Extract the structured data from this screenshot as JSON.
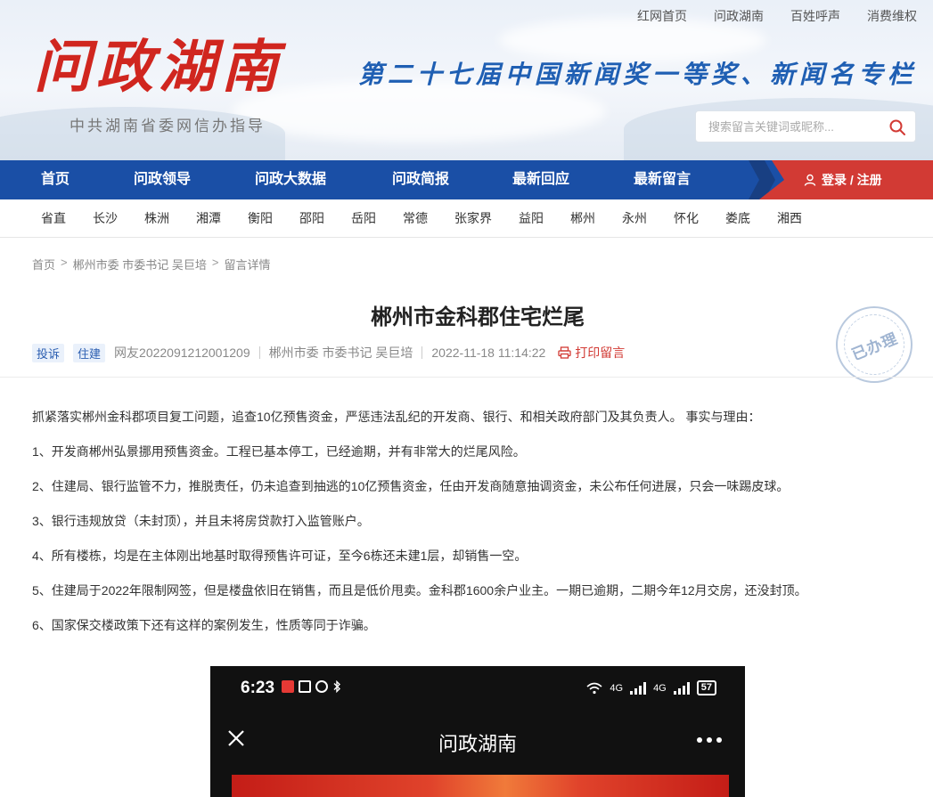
{
  "top_links": [
    "红网首页",
    "问政湖南",
    "百姓呼声",
    "消费维权"
  ],
  "logo": {
    "text": "问政湖南",
    "subtitle": "中共湖南省委网信办指导"
  },
  "slogan": "第二十七届中国新闻奖一等奖、新闻名专栏",
  "search": {
    "placeholder": "搜索留言关键词或昵称..."
  },
  "nav": {
    "items": [
      "首页",
      "问政领导",
      "问政大数据",
      "问政简报",
      "最新回应",
      "最新留言"
    ],
    "login_label": "登录 / 注册"
  },
  "regions": [
    "省直",
    "长沙",
    "株洲",
    "湘潭",
    "衡阳",
    "邵阳",
    "岳阳",
    "常德",
    "张家界",
    "益阳",
    "郴州",
    "永州",
    "怀化",
    "娄底",
    "湘西"
  ],
  "breadcrumb": [
    "首页",
    "郴州市委 市委书记 吴巨培",
    "留言详情"
  ],
  "post": {
    "title": "郴州市金科郡住宅烂尾",
    "tags": [
      "投诉",
      "住建"
    ],
    "author": "网友2022091212001209",
    "target": "郴州市委 市委书记 吴巨培",
    "time": "2022-11-18 11:14:22",
    "print_label": "打印留言",
    "stamp": "已办理",
    "paragraphs": [
      "抓紧落实郴州金科郡项目复工问题，追查10亿预售资金，严惩违法乱纪的开发商、银行、和相关政府部门及其负责人。 事实与理由：",
      "1、开发商郴州弘景挪用预售资金。工程已基本停工，已经逾期，并有非常大的烂尾风险。",
      "2、住建局、银行监管不力，推脱责任，仍未追查到抽逃的10亿预售资金，任由开发商随意抽调资金，未公布任何进展，只会一味踢皮球。",
      "3、银行违规放贷（未封顶），并且未将房贷款打入监管账户。",
      "4、所有楼栋，均是在主体刚出地基时取得预售许可证，至今6栋还未建1层，却销售一空。",
      "5、住建局于2022年限制网签，但是楼盘依旧在销售，而且是低价甩卖。金科郡1600余户业主。一期已逾期，二期今年12月交房，还没封顶。",
      "6、国家保交楼政策下还有这样的案例发生，性质等同于诈骗。"
    ]
  },
  "phone": {
    "time": "6:23",
    "net_label_1": "4G",
    "net_label_2": "4G",
    "battery": "57",
    "title": "问政湖南"
  },
  "colors": {
    "nav_blue": "#1a4fa6",
    "accent_red": "#d23a34",
    "logo_red": "#d0261f",
    "slogan_blue": "#1f5fb3"
  }
}
